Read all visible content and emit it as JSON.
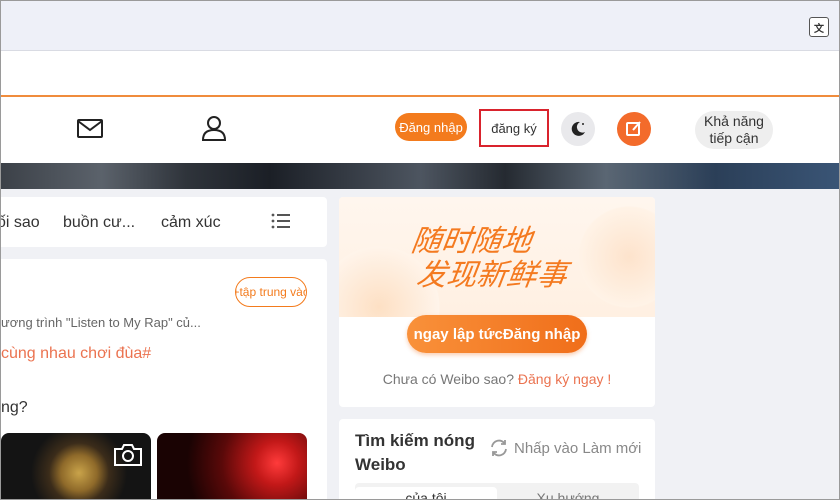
{
  "browser": {
    "translate_icon": "translate-icon"
  },
  "header": {
    "login_label": "Đăng nhập",
    "register_label": "đăng ký",
    "accessibility_label_line1": "Khả năng",
    "accessibility_label_line2": "tiếp cận",
    "icons": [
      "mail-icon",
      "user-icon",
      "moon-icon",
      "compose-icon"
    ],
    "accent_color": "#f37b1d"
  },
  "tabs": [
    {
      "label": "ối sao"
    },
    {
      "label": "buồn cư..."
    },
    {
      "label": "cảm xúc"
    }
  ],
  "feed": {
    "follow_label": "+tập trung vào",
    "description": "ương trình \"Listen to My Rap\" củ...",
    "hashtag": "cùng nhau chơi đùa#",
    "question": "ng?"
  },
  "login_card": {
    "slogan_line1": "随时随地",
    "slogan_line2": "发现新鲜事",
    "login_button": "ngay lập tứcĐăng nhập",
    "no_account": "Chưa có Weibo sao? ",
    "register_link": "Đăng ký ngay !"
  },
  "hot_search": {
    "title_line1": "Tìm kiếm nóng",
    "title_line2": "Weibo",
    "refresh_label": "Nhấp vào Làm mới",
    "tab_mine": "của tôi",
    "tab_trend": "Xu hướng"
  }
}
